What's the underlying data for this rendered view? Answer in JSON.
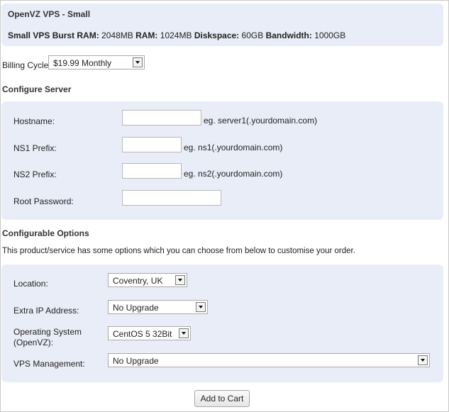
{
  "product": {
    "title": "OpenVZ VPS - Small",
    "specs": [
      {
        "key": "Small VPS Burst RAM:",
        "value": "2048MB"
      },
      {
        "key": "RAM:",
        "value": "1024MB"
      },
      {
        "key": "Diskspace:",
        "value": "60GB"
      },
      {
        "key": "Bandwidth:",
        "value": "1000GB"
      }
    ]
  },
  "billing": {
    "label": "Billing Cycle:",
    "selected": "$19.99 Monthly"
  },
  "configure_server": {
    "heading": "Configure Server",
    "fields": [
      {
        "label": "Hostname:",
        "value": "",
        "hint": "eg. server1(.yourdomain.com)"
      },
      {
        "label": "NS1 Prefix:",
        "value": "",
        "hint": "eg. ns1(.yourdomain.com)"
      },
      {
        "label": "NS2 Prefix:",
        "value": "",
        "hint": "eg. ns2(.yourdomain.com)"
      },
      {
        "label": "Root Password:",
        "value": ""
      }
    ]
  },
  "configurable_options": {
    "heading": "Configurable Options",
    "intro": "This product/service has some options which you can choose from below to customise your order.",
    "options": [
      {
        "label": "Location:",
        "selected": "Coventry, UK"
      },
      {
        "label": "Extra IP Address:",
        "selected": "No Upgrade"
      },
      {
        "label_line1": "Operating System",
        "label_line2": "(OpenVZ):",
        "selected": "CentOS 5 32Bit"
      },
      {
        "label": "VPS Management:",
        "selected": "No Upgrade"
      }
    ]
  },
  "actions": {
    "add_to_cart": "Add to Cart"
  }
}
